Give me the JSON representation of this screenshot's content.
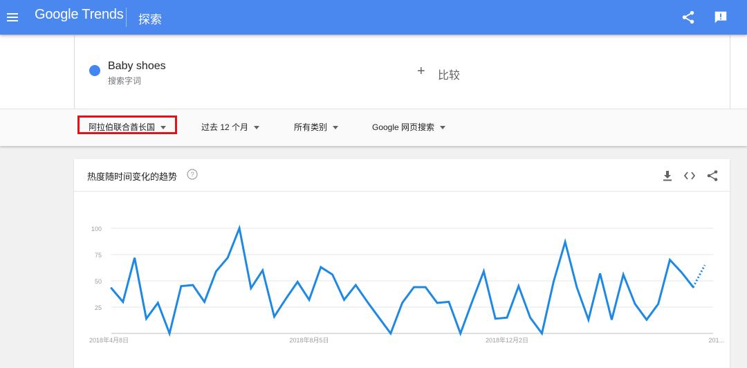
{
  "header": {
    "logo_google": "Google",
    "logo_trends": "Trends",
    "page_name": "探索"
  },
  "search_term": {
    "name": "Baby shoes",
    "type_label": "搜索字词",
    "color": "#4285f4"
  },
  "compare": {
    "label": "比较"
  },
  "filters": {
    "region": "阿拉伯联合酋长国",
    "time": "过去 12 个月",
    "category": "所有类别",
    "search_type": "Google 网页搜索"
  },
  "card": {
    "title": "热度随时间变化的趋势"
  },
  "chart_data": {
    "type": "line",
    "title": "",
    "y_ticks": [
      "100",
      "75",
      "50",
      "25"
    ],
    "ylim": [
      0,
      100
    ],
    "x_tick_labels": [
      "2018年4月8日",
      "2018年8月5日",
      "2018年12月2日",
      "201..."
    ],
    "x_tick_indices": [
      0,
      17,
      34,
      52
    ],
    "grid": true,
    "series": [
      {
        "name": "Baby shoes",
        "color": "#1e88e5",
        "values": [
          43,
          30,
          72,
          14,
          29,
          0,
          45,
          46,
          30,
          59,
          72,
          100,
          43,
          60,
          16,
          33,
          49,
          32,
          63,
          56,
          32,
          46,
          30,
          15,
          0,
          29,
          44,
          44,
          29,
          30,
          0,
          30,
          59,
          14,
          15,
          45,
          15,
          0,
          49,
          87,
          44,
          13,
          57,
          13,
          56,
          28,
          13,
          28,
          70,
          58,
          44,
          65
        ],
        "partial_from_index": 50
      }
    ]
  }
}
